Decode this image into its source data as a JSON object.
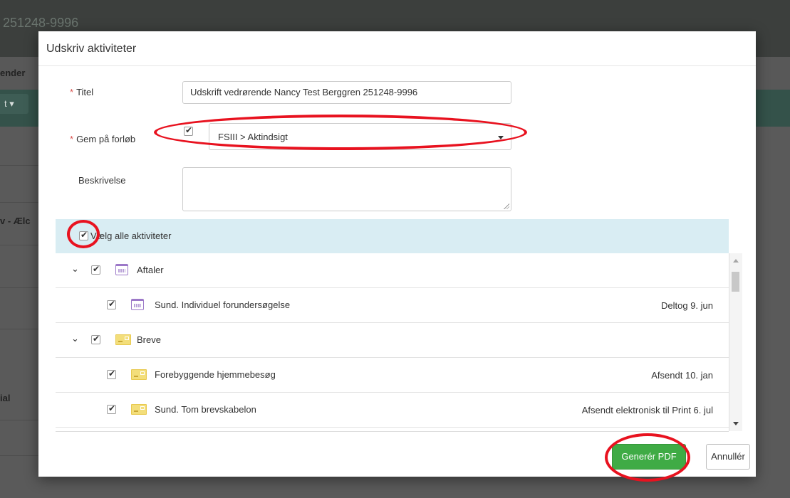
{
  "background": {
    "page_title": "251248-9996",
    "nav_text": "ender",
    "toolbar_button": "t",
    "side_labels": [
      "v - Ælc",
      "ial"
    ]
  },
  "modal": {
    "title": "Udskriv aktiviteter",
    "required_mark": "*",
    "fields": {
      "titel_label": "Titel",
      "titel_value": "Udskrift vedrørende Nancy Test Berggren 251248-9996",
      "gem_label": "Gem på forløb",
      "gem_checked": true,
      "gem_select_value": "FSIII > Aktindsigt",
      "beskrivelse_label": "Beskrivelse",
      "beskrivelse_value": ""
    },
    "select_all_label": "Vælg alle aktiviteter",
    "groups": [
      {
        "label": "Aftaler",
        "icon": "calendar-icon",
        "items": [
          {
            "label": "Sund. Individuel forundersøgelse",
            "status": "Deltog 9. jun"
          }
        ]
      },
      {
        "label": "Breve",
        "icon": "letter-icon",
        "items": [
          {
            "label": "Forebyggende hjemmebesøg",
            "status": "Afsendt 10. jan"
          },
          {
            "label": "Sund. Tom brevskabelon",
            "status": "Afsendt elektronisk til Print 6. jul"
          }
        ]
      }
    ],
    "buttons": {
      "generate": "Generér PDF",
      "cancel": "Annullér"
    }
  },
  "colors": {
    "primary_green": "#3fab45",
    "highlight_blue": "#d9edf3",
    "required_red": "#d9534f",
    "annotation_red": "#e8121f"
  }
}
